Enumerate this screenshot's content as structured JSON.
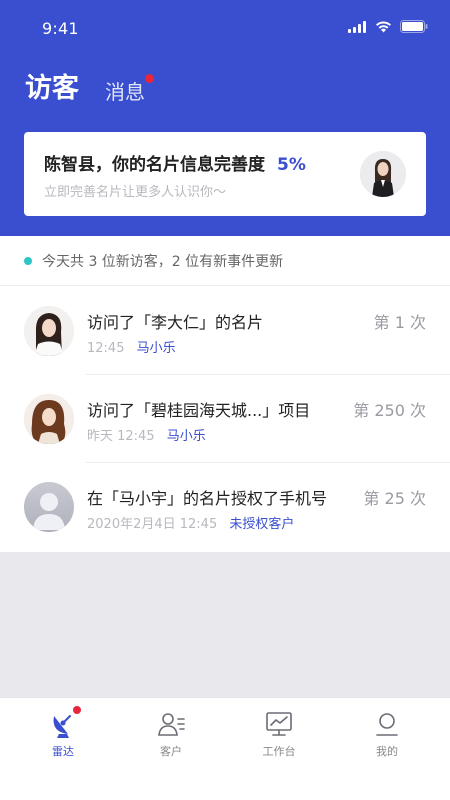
{
  "status_bar": {
    "time": "9:41"
  },
  "header": {
    "tabs": [
      {
        "label": "访客",
        "active": true
      },
      {
        "label": "消息",
        "active": false,
        "has_dot": true
      }
    ]
  },
  "profile_card": {
    "title": "陈智县，你的名片信息完善度",
    "percent": "5%",
    "subtitle": "立即完善名片让更多人认识你～"
  },
  "summary": {
    "text": "今天共 3 位新访客，2 位有新事件更新"
  },
  "visits": [
    {
      "title": "访问了「李大仁」的名片",
      "time": "12:45",
      "person": "马小乐",
      "count": "第 1 次",
      "avatar": "woman-smiling"
    },
    {
      "title": "访问了「碧桂园海天城...」项目",
      "time": "昨天 12:45",
      "person": "马小乐",
      "count": "第 250 次",
      "avatar": "woman-posing"
    },
    {
      "title": "在「马小宇」的名片授权了手机号",
      "time": "2020年2月4日 12:45",
      "person": "未授权客户",
      "count": "第 25 次",
      "avatar": "default-person"
    }
  ],
  "bottom_nav": [
    {
      "label": "雷达",
      "icon": "radar-icon",
      "active": true,
      "has_dot": true
    },
    {
      "label": "客户",
      "icon": "customer-icon",
      "active": false
    },
    {
      "label": "工作台",
      "icon": "workbench-icon",
      "active": false
    },
    {
      "label": "我的",
      "icon": "profile-icon",
      "active": false
    }
  ],
  "colors": {
    "primary": "#3a4fcf",
    "badge_red": "#e8263b",
    "summary_dot": "#2cc6c6"
  }
}
